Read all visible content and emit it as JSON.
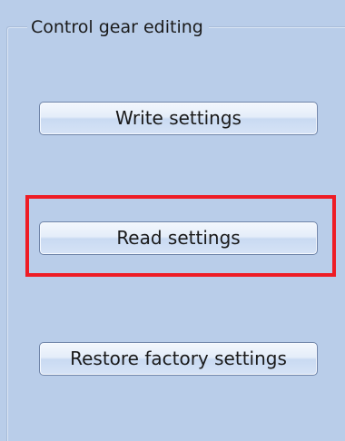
{
  "groupbox": {
    "title": "Control gear editing"
  },
  "buttons": {
    "write_label": "Write settings",
    "read_label": "Read settings",
    "restore_label": "Restore factory settings"
  },
  "colors": {
    "panel_background": "#b9cde9",
    "highlight_border": "#ee1c25"
  }
}
